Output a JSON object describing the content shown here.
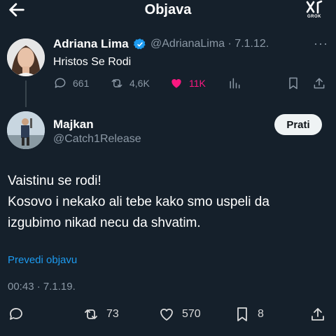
{
  "header": {
    "title": "Objava",
    "grok_label": "GROK"
  },
  "original": {
    "name": "Adriana Lima",
    "handle_date": "@AdrianaLima · 7.1.12.",
    "more": "···",
    "text": "Hristos Se Rodi",
    "replies": "661",
    "reposts": "4,6K",
    "likes": "11K",
    "liked": true
  },
  "reply": {
    "name": "Majkan",
    "handle": "@Catch1Release",
    "follow_label": "Prati",
    "text_lines": [
      "Vaistinu se rodi!",
      "Kosovo i nekako ali tebe kako smo uspeli da",
      "izgubimo nikad necu da shvatim."
    ],
    "translate": "Prevedi objavu",
    "timestamp": "00:43 · 7.1.19.",
    "reposts": "73",
    "likes": "570",
    "bookmarks": "8"
  },
  "colors": {
    "background": "#15202b",
    "muted": "#8b98a5",
    "link": "#1d9bf0",
    "like": "#f91880",
    "verified": "#1d9bf0"
  },
  "icons": [
    "back-arrow-icon",
    "grok-icon",
    "verified-badge-icon",
    "more-icon",
    "reply-icon",
    "repost-icon",
    "heart-icon",
    "views-icon",
    "bookmark-icon",
    "share-icon"
  ]
}
